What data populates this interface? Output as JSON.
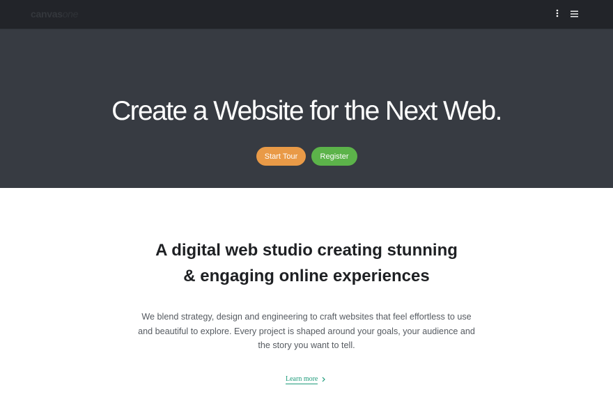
{
  "header": {
    "logo_main": "canvas",
    "logo_suffix": "one",
    "more_icon": "vertical-dots-icon",
    "menu_icon": "hamburger-icon"
  },
  "hero": {
    "title": "Create a Website for the Next Web.",
    "start_tour_label": "Start Tour",
    "register_label": "Register",
    "colors": {
      "background": "#373b42",
      "start_tour": "#e99a47",
      "register": "#5cb34a"
    }
  },
  "intro": {
    "headline_line1": "A digital web studio creating stunning",
    "headline_line2": "& engaging online experiences",
    "paragraph": "We blend strategy, design and engineering to craft websites that feel effortless to use and beautiful to explore. Every project is shaped around your goals, your audience and the story you want to tell.",
    "learn_more_label": "Learn more",
    "learn_more_icon": "chevron-right-icon",
    "accent_color": "#1d9b7a"
  }
}
